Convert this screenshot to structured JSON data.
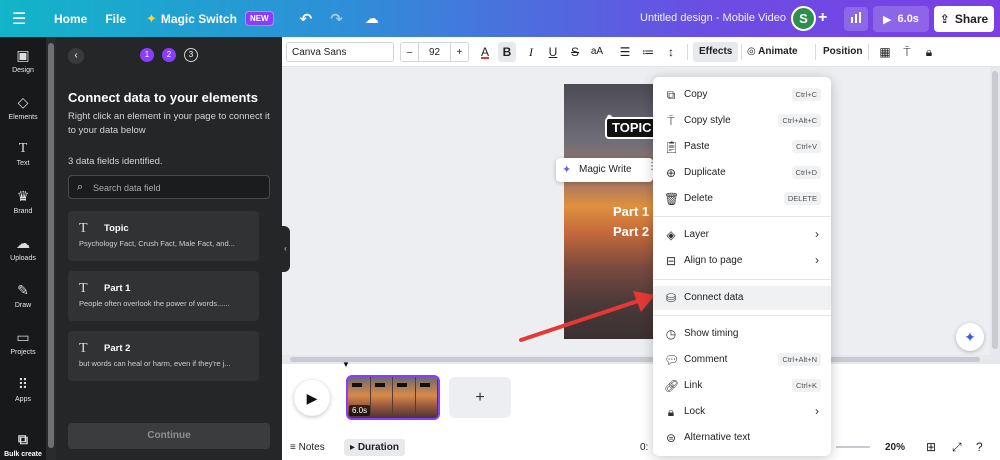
{
  "topbar": {
    "home": "Home",
    "file": "File",
    "magic_switch": "Magic Switch",
    "new_badge": "NEW",
    "title": "Untitled design - Mobile Video",
    "avatar_initial": "S",
    "play_duration": "6.0s",
    "share": "Share"
  },
  "rail": {
    "items": [
      "Design",
      "Elements",
      "Text",
      "Brand",
      "Uploads",
      "Draw",
      "Projects",
      "Apps",
      "Bulk create"
    ]
  },
  "panel": {
    "steps": [
      "1",
      "2",
      "3"
    ],
    "title": "Connect data to your elements",
    "description": "Right click an element in your page to connect it to your data below",
    "count": "3 data fields identified.",
    "search_placeholder": "Search data field",
    "fields": [
      {
        "name": "Topic",
        "preview": "Psychology Fact, Crush Fact, Male Fact, and..."
      },
      {
        "name": "Part 1",
        "preview": "People often overlook the power of words......"
      },
      {
        "name": "Part 2",
        "preview": "but words can heal or harm, even if they're j..."
      }
    ],
    "continue": "Continue"
  },
  "toolbar": {
    "font": "Canva Sans",
    "size_minus": "–",
    "size": "92",
    "size_plus": "+",
    "text_color_letter": "A",
    "bold": "B",
    "italic": "I",
    "underline": "U",
    "strike": "S",
    "case": "aA",
    "effects": "Effects",
    "animate": "Animate",
    "position": "Position"
  },
  "canvas": {
    "topic_text": "TOPIC",
    "part1_text": "Part 1",
    "part2_text": "Part 2",
    "magic_write": "Magic Write"
  },
  "context_menu": {
    "items": [
      {
        "icon": "copy-icon",
        "label": "Copy",
        "shortcut": "Ctrl+C"
      },
      {
        "icon": "paint-roller-icon",
        "label": "Copy style",
        "shortcut": "Ctrl+Alt+C"
      },
      {
        "icon": "clipboard-icon",
        "label": "Paste",
        "shortcut": "Ctrl+V"
      },
      {
        "icon": "duplicate-icon",
        "label": "Duplicate",
        "shortcut": "Ctrl+D"
      },
      {
        "icon": "trash-icon",
        "label": "Delete",
        "shortcut": "DELETE"
      },
      {
        "icon": "layers-icon",
        "label": "Layer",
        "shortcut": ""
      },
      {
        "icon": "align-icon",
        "label": "Align to page",
        "shortcut": ""
      },
      {
        "icon": "database-icon",
        "label": "Connect data",
        "shortcut": ""
      },
      {
        "icon": "clock-icon",
        "label": "Show timing",
        "shortcut": ""
      },
      {
        "icon": "comment-icon",
        "label": "Comment",
        "shortcut": "Ctrl+Alt+N"
      },
      {
        "icon": "link-icon",
        "label": "Link",
        "shortcut": "Ctrl+K"
      },
      {
        "icon": "lock-icon",
        "label": "Lock",
        "shortcut": ""
      },
      {
        "icon": "alt-text-icon",
        "label": "Alternative text",
        "shortcut": ""
      }
    ]
  },
  "timeline": {
    "clip_duration": "6.0s"
  },
  "bottombar": {
    "notes": "Notes",
    "duration": "Duration",
    "time": "0:",
    "zoom": "20%"
  },
  "colors": {
    "accent": "#8b3dff",
    "arrow": "#e53935",
    "panel_bg": "#252627"
  }
}
